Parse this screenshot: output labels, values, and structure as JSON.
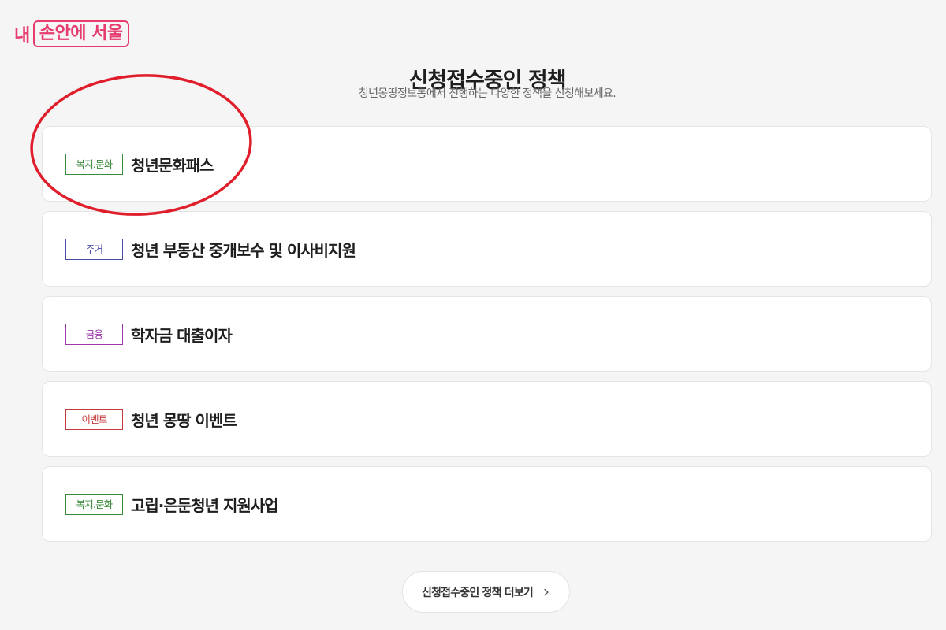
{
  "logo": {
    "prefix": "내",
    "boxed": "손안에 서울",
    "color": "#e63c6e"
  },
  "section": {
    "title": "신청접수중인 정책",
    "subtitle": "청년몽땅정보통에서 진행하는 다양한 정책을 신청해보세요."
  },
  "policies": [
    {
      "tag": "복지.문화",
      "tag_color": "#3a8a3a",
      "name": "청년문화패스"
    },
    {
      "tag": "주거",
      "tag_color": "#4a4aa8",
      "name": "청년 부동산 중개보수 및 이사비지원"
    },
    {
      "tag": "금융",
      "tag_color": "#9b3aa8",
      "name": "학자금 대출이자"
    },
    {
      "tag": "이벤트",
      "tag_color": "#c43a3a",
      "name": "청년 몽땅 이벤트"
    },
    {
      "tag": "복지.문화",
      "tag_color": "#3a8a3a",
      "name": "고립·은둔청년 지원사업"
    }
  ],
  "more_button": {
    "label": "신청접수중인 정책 더보기",
    "icon": "chevron-right-icon"
  },
  "annotation": {
    "color": "#e01e2b"
  }
}
